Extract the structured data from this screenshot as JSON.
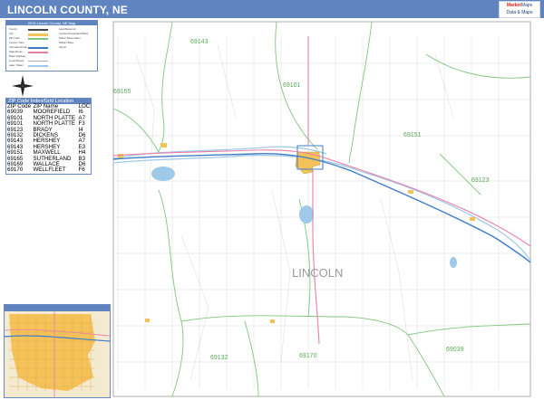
{
  "header": {
    "title": "LINCOLN COUNTY, NE"
  },
  "brand": {
    "line1": "Market",
    "line2": "Maps",
    "line3": "Data & Maps"
  },
  "legend": {
    "title": "2018 Lincoln County, NE Map",
    "items": [
      "County",
      "City",
      "ZIP Code",
      "Census Tract",
      "Interstate Route",
      "State Route",
      "Major Highway",
      "Local Streets",
      "Lake / Water",
      "Trail",
      "Rail Road"
    ],
    "col2": [
      "Lake/Reservoir",
      "Census Designated Place",
      "Native Reservation",
      "Military Base",
      "Airport"
    ]
  },
  "zip_index": {
    "title": "ZIP Code Index/Grid Location",
    "headers": [
      "ZIP Code",
      "ZIP Name",
      "LOC"
    ],
    "rows": [
      [
        "69039",
        "MOOREFIELD",
        "I6"
      ],
      [
        "69101",
        "NORTH PLATTE",
        "A7"
      ],
      [
        "69101",
        "NORTH PLATTE",
        "F3"
      ],
      [
        "69123",
        "BRADY",
        "I4"
      ],
      [
        "69132",
        "DICKENS",
        "D6"
      ],
      [
        "69143",
        "HERSHEY",
        "A7"
      ],
      [
        "69143",
        "HERSHEY",
        "E3"
      ],
      [
        "69151",
        "MAXWELL",
        "H4"
      ],
      [
        "69165",
        "SUTHERLAND",
        "B3"
      ],
      [
        "69169",
        "WALLACE",
        "D6"
      ],
      [
        "69170",
        "WELLFLEET",
        "F6"
      ]
    ]
  },
  "map_labels": {
    "county": "LINCOLN",
    "zips": [
      "69143",
      "69101",
      "69165",
      "69151",
      "69123",
      "69132",
      "69170",
      "69039"
    ]
  },
  "colors": {
    "header": "#5f84c0",
    "zip_boundary": "#7ec77e",
    "city": "#f5c25a",
    "water": "#9fc9e8",
    "interstate": "#3f7cc8",
    "highway": "#e87fa8",
    "road": "#bdbdbd"
  }
}
